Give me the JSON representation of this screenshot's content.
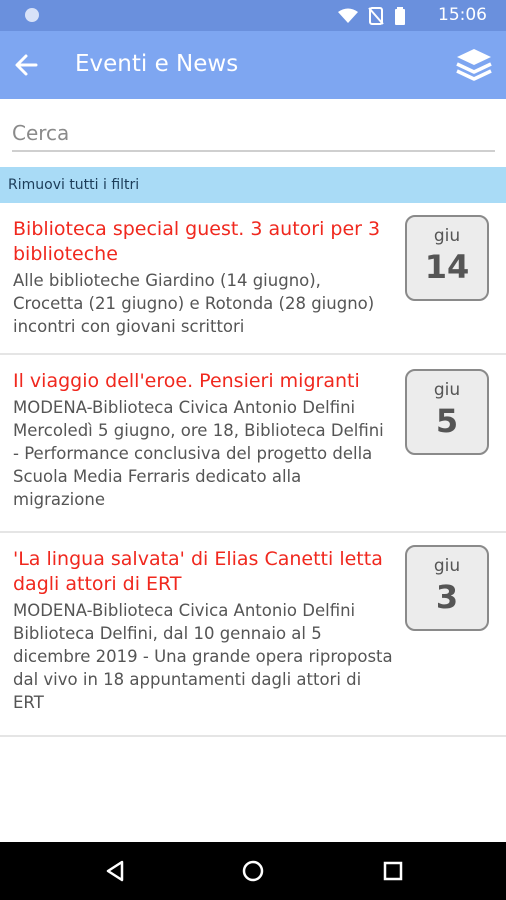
{
  "status": {
    "time": "15:06"
  },
  "appbar": {
    "title": "Eventi e News"
  },
  "search": {
    "placeholder": "Cerca"
  },
  "filter": {
    "label": "Rimuovi tutti i filtri"
  },
  "events": [
    {
      "title": "Biblioteca special guest. 3 autori per 3 biblioteche",
      "desc": "Alle biblioteche Giardino (14 giugno), Crocetta (21 giugno) e Rotonda (28 giugno) incontri con giovani scrittori",
      "month": "giu",
      "day": "14"
    },
    {
      "title": "Il viaggio dell'eroe. Pensieri migranti",
      "desc": "MODENA-Biblioteca Civica Antonio Delfini Mercoledì 5 giugno, ore 18, Biblioteca Delfini - Performance conclusiva del progetto della Scuola Media Ferraris dedicato alla migrazione",
      "month": "giu",
      "day": "5"
    },
    {
      "title": "'La lingua salvata' di Elias Canetti letta dagli attori di ERT",
      "desc": "MODENA-Biblioteca Civica Antonio Delfini Biblioteca Delfini, dal 10 gennaio al 5 dicembre 2019 - Una grande opera riproposta dal vivo in 18 appuntamenti dagli attori di ERT",
      "month": "giu",
      "day": "3"
    }
  ]
}
